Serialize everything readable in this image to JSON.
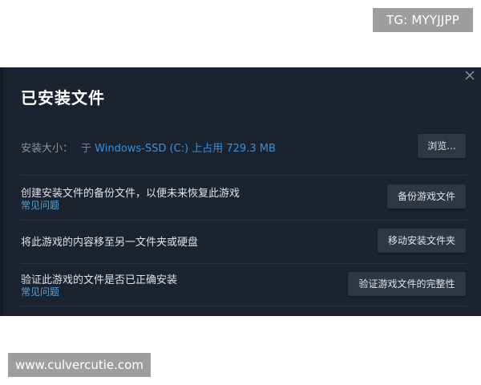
{
  "watermarks": {
    "tg": "TG: MYYJJPP",
    "site": "www.culvercutie.com"
  },
  "dialog": {
    "title": "已安装文件",
    "install_size": {
      "label": "安装大小：",
      "value": "于 Windows-SSD (C:) 上占用 729.3 MB"
    },
    "browse_button": "浏览...",
    "backup": {
      "description": "创建安装文件的备份文件，以便未来恢复此游戏",
      "faq_link": "常见问题",
      "button": "备份游戏文件"
    },
    "move": {
      "description": "将此游戏的内容移至另一文件夹或硬盘",
      "button": "移动安装文件夹"
    },
    "verify": {
      "description": "验证此游戏的文件是否已正确安装",
      "faq_link": "常见问题",
      "button": "验证游戏文件的完整性"
    }
  },
  "colors": {
    "panel_bg": "#1b2230",
    "accent_link": "#57a5d8",
    "size_value": "#3d8fd9",
    "button_bg": "#2e3644"
  }
}
